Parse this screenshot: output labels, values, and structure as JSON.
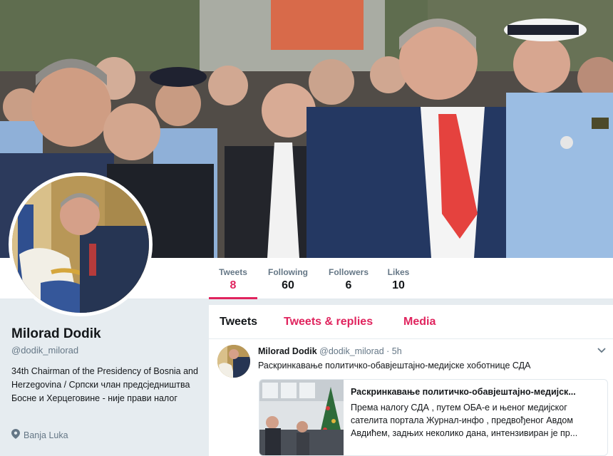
{
  "profile": {
    "name": "Milorad Dodik",
    "handle": "@dodik_milorad",
    "bio": "34th Chairman of the Presidency of Bosnia and Herzegovina / Српски члан предсједништва Босне и Херцеговине - није прави налог",
    "location": "Banja Luka"
  },
  "stats": [
    {
      "label": "Tweets",
      "value": "8"
    },
    {
      "label": "Following",
      "value": "60"
    },
    {
      "label": "Followers",
      "value": "6"
    },
    {
      "label": "Likes",
      "value": "10"
    }
  ],
  "tabs": [
    "Tweets",
    "Tweets & replies",
    "Media"
  ],
  "tweet": {
    "author": "Milorad Dodik",
    "handle": "@dodik_milorad",
    "separator": "·",
    "time": "5h",
    "text": "Раскринкавање политичко-обавјештајно-медијске хоботнице СДА",
    "card": {
      "title": "Раскринкавање политичко-обавјештајно-медијск...",
      "description": "Према налогу СДА , путем ОБА-е и њеног медијског сателита портала Журнал-инфо , предвођеног Авдом Авдићем, задњих неколико дана, интензивиран је пр..."
    }
  },
  "colors": {
    "accent": "#e0245e",
    "text": "#14171a",
    "muted": "#657786",
    "background": "#e6ecf0"
  },
  "icons": {
    "location": "location-pin-icon",
    "caret": "chevron-down-icon"
  }
}
